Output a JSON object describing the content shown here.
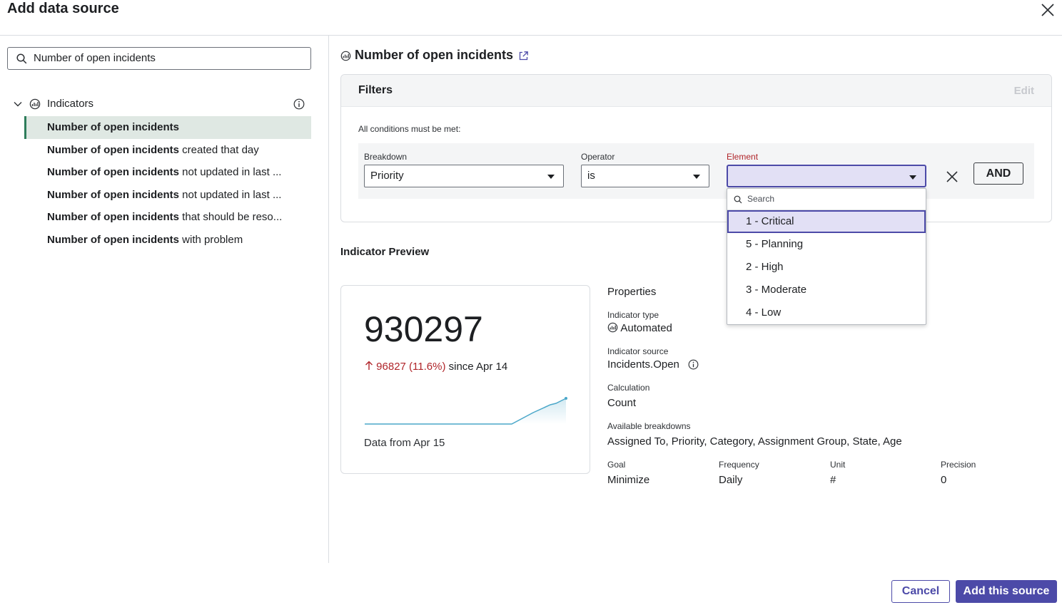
{
  "header": {
    "title": "Add data source"
  },
  "left": {
    "search_value": "Number of open incidents",
    "tree": {
      "label": "Indicators",
      "items": [
        {
          "bold": "Number of open incidents",
          "rest": ""
        },
        {
          "bold": "Number of open incidents",
          "rest": " created that day"
        },
        {
          "bold": "Number of open incidents",
          "rest": " not updated in last ..."
        },
        {
          "bold": "Number of open incidents",
          "rest": " not updated in last ..."
        },
        {
          "bold": "Number of open incidents",
          "rest": " that should be reso..."
        },
        {
          "bold": "Number of open incidents",
          "rest": " with problem"
        }
      ]
    }
  },
  "main": {
    "title": "Number of open incidents",
    "filters": {
      "title": "Filters",
      "edit_label": "Edit",
      "condition_text": "All conditions must be met:",
      "breakdown_label": "Breakdown",
      "breakdown_value": "Priority",
      "operator_label": "Operator",
      "operator_value": "is",
      "element_label": "Element",
      "element_value": "",
      "and_label": "AND"
    },
    "dropdown": {
      "search_placeholder": "Search",
      "options": [
        "1 - Critical",
        "5 - Planning",
        "2 - High",
        "3 - Moderate",
        "4 - Low"
      ],
      "highlighted_index": 0
    },
    "preview": {
      "title": "Indicator Preview",
      "value": "930297",
      "delta": "96827 (11.6%)",
      "delta_suffix": " since Apr 14",
      "data_from": "Data from Apr 15",
      "accent_color": "#4aa7c9",
      "delta_color": "#b0252a"
    },
    "properties": {
      "title": "Properties",
      "indicator_type_label": "Indicator type",
      "indicator_type": "Automated",
      "indicator_source_label": "Indicator source",
      "indicator_source": "Incidents.Open",
      "calculation_label": "Calculation",
      "calculation": "Count",
      "breakdowns_label": "Available breakdowns",
      "breakdowns": "Assigned To, Priority, Category, Assignment Group, State, Age",
      "goal_label": "Goal",
      "goal": "Minimize",
      "frequency_label": "Frequency",
      "frequency": "Daily",
      "unit_label": "Unit",
      "unit": "#",
      "precision_label": "Precision",
      "precision": "0"
    }
  },
  "footer": {
    "cancel_label": "Cancel",
    "add_label": "Add this source"
  },
  "colors": {
    "primary": "#4c4aa8",
    "selected_row": "#dfe8e3",
    "selected_bar": "#2e7d5b"
  }
}
